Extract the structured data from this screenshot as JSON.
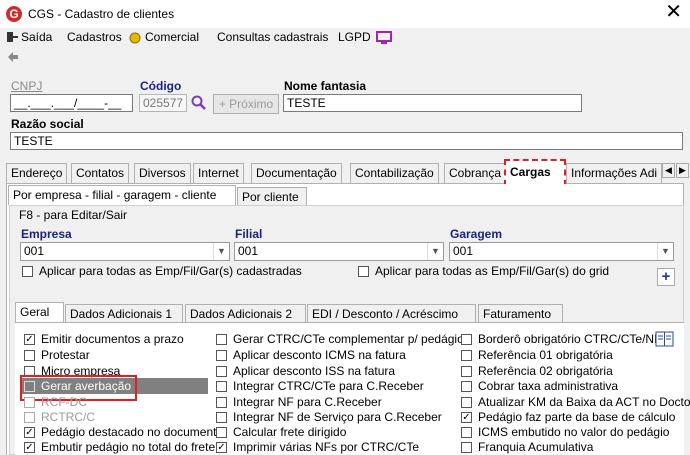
{
  "window": {
    "title": "CGS - Cadastro de clientes",
    "app_icon_letter": "G",
    "close_glyph": "✕"
  },
  "menu": {
    "items": [
      "Saída",
      "Cadastros",
      "Comercial",
      "Consultas cadastrais",
      "LGPD"
    ]
  },
  "header_fields": {
    "cnpj_label": "CNPJ",
    "cnpj_value": "__.___.___/____-__",
    "codigo_label": "Código",
    "codigo_value": "025577",
    "proximo_label": "Próximo",
    "nome_fantasia_label": "Nome fantasia",
    "nome_fantasia_value": "TESTE",
    "razao_social_label": "Razão social",
    "razao_social_value": "TESTE"
  },
  "main_tabs": [
    "Endereço",
    "Contatos",
    "Diversos",
    "Internet",
    "Documentação",
    "Contabilização",
    "Cobrança",
    "Cargas",
    "Informações Adi"
  ],
  "active_main_tab": "Cargas",
  "cargas_tabs": [
    "Por empresa - filial - garagem - cliente",
    "Por cliente"
  ],
  "f8_label": "F8 - para Editar/Sair",
  "selectors": {
    "empresa_label": "Empresa",
    "empresa_value": "001",
    "filial_label": "Filial",
    "filial_value": "001",
    "garagem_label": "Garagem",
    "garagem_value": "001",
    "aplicar_emp": "Aplicar para todas as Emp/Fil/Gar(s) cadastradas",
    "aplicar_grid": "Aplicar para todas as Emp/Fil/Gar(s) do grid",
    "plus": "+"
  },
  "inner_tabs": [
    "Geral",
    "Dados Adicionais 1",
    "Dados Adicionais 2",
    "EDI / Desconto / Acréscimo",
    "Faturamento"
  ],
  "col1": [
    {
      "label": "Emitir documentos a prazo",
      "checked": true,
      "disabled": false
    },
    {
      "label": "Protestar",
      "checked": false,
      "disabled": false
    },
    {
      "label": "Micro empresa",
      "checked": false,
      "disabled": false
    },
    {
      "label": "Gerar averbação",
      "checked": false,
      "disabled": false
    },
    {
      "label": "RCF-DC",
      "checked": false,
      "disabled": true
    },
    {
      "label": "RCTRC/C",
      "checked": false,
      "disabled": true
    },
    {
      "label": "Pedágio destacado no documento",
      "checked": true,
      "disabled": false
    },
    {
      "label": "Embutir pedágio no total do frete",
      "checked": true,
      "disabled": false
    }
  ],
  "col2": [
    {
      "label": "Gerar CTRC/CTe complementar p/ pedágio",
      "checked": false
    },
    {
      "label": "Aplicar desconto ICMS na fatura",
      "checked": false
    },
    {
      "label": "Aplicar desconto ISS na fatura",
      "checked": false
    },
    {
      "label": "Integrar CTRC/CTe para C.Receber",
      "checked": false
    },
    {
      "label": "Integrar NF para C.Receber",
      "checked": false
    },
    {
      "label": "Integrar NF de Serviço para C.Receber",
      "checked": false
    },
    {
      "label": "Calcular frete dirigido",
      "checked": false
    },
    {
      "label": "Imprimir várias NFs por CTRC/CTe",
      "checked": true
    }
  ],
  "col3": [
    {
      "label": "Borderô obrigatório  CTRC/CTe/NF",
      "checked": false
    },
    {
      "label": "Referência 01 obrigatória",
      "checked": false
    },
    {
      "label": "Referência 02 obrigatória",
      "checked": false
    },
    {
      "label": "Cobrar taxa administrativa",
      "checked": false
    },
    {
      "label": "Atualizar KM da Baixa da ACT no Docto",
      "checked": false
    },
    {
      "label": "Pedágio faz parte da base de cálculo",
      "checked": true
    },
    {
      "label": "ICMS embutido no valor do pedágio",
      "checked": false
    },
    {
      "label": "Franquia Acumulativa",
      "checked": false
    }
  ],
  "colors": {
    "highlight": "#e02020",
    "label_blue": "#1a237e",
    "selected_row": "#808080"
  }
}
